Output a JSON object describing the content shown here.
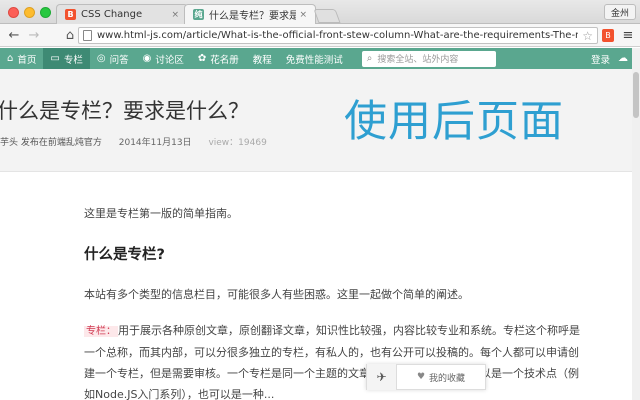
{
  "browser": {
    "tabs": [
      {
        "label": "CSS Change",
        "favicon_letter": "B"
      },
      {
        "label": "什么是专栏？要求是什么？",
        "favicon_letter": "纯"
      }
    ],
    "tab_close": "×",
    "profile_label": "金州",
    "url": "www.html-js.com/article/What-is-the-official-front-stew-column-What-are-the-requirements-The-reward",
    "extension_letter": "B",
    "icons": {
      "back": "←",
      "forward": "→",
      "home": "⌂",
      "star": "☆",
      "menu": "≡"
    }
  },
  "site_nav": {
    "items": [
      {
        "icon": "⌂",
        "label": "首页"
      },
      {
        "icon": "▭",
        "label": "专栏"
      },
      {
        "icon": "◎",
        "label": "问答"
      },
      {
        "icon": "◉",
        "label": "讨论区"
      },
      {
        "icon": "✿",
        "label": "花名册"
      },
      {
        "icon": "",
        "label": "教程"
      },
      {
        "icon": "",
        "label": "免费性能测试"
      }
    ],
    "search_placeholder": "搜索全站、站外内容",
    "search_icon": "⌕",
    "login_label": "登录",
    "cloud_icon": "☁"
  },
  "article": {
    "title": "什么是专栏？要求是什么？",
    "author": "芋头 发布在前端乱炖官方",
    "date": "2014年11月13日",
    "views": "view：19469",
    "intro": "这里是专栏第一版的简单指南。",
    "h2": "什么是专栏?",
    "para1": "本站有多个类型的信息栏目，可能很多人有些困惑。这里一起做个简单的阐述。",
    "para2_tag": "专栏：",
    "para2_text": "用于展示各种原创文章，原创翻译文章，知识性比较强，内容比较专业和系统。专栏这个称呼是一个总称，而其内部，可以分很多独立的专栏，有私人的，也有公开可以投稿的。每个人都可以申请创建一个专栏，但是需要审核。一个专栏是同一个主题的文章的集合，而这个系列可以是一个技术点（例如Node.JS入门系列），也可以是一种..."
  },
  "overlay_label": "使用后页面",
  "float_bar": {
    "top_icon": "✈",
    "fav_icon": "♥",
    "fav_label": "我的收藏"
  },
  "colors": {
    "nav_green": "#5aa78f",
    "overlay_blue": "#2e9fd1"
  }
}
